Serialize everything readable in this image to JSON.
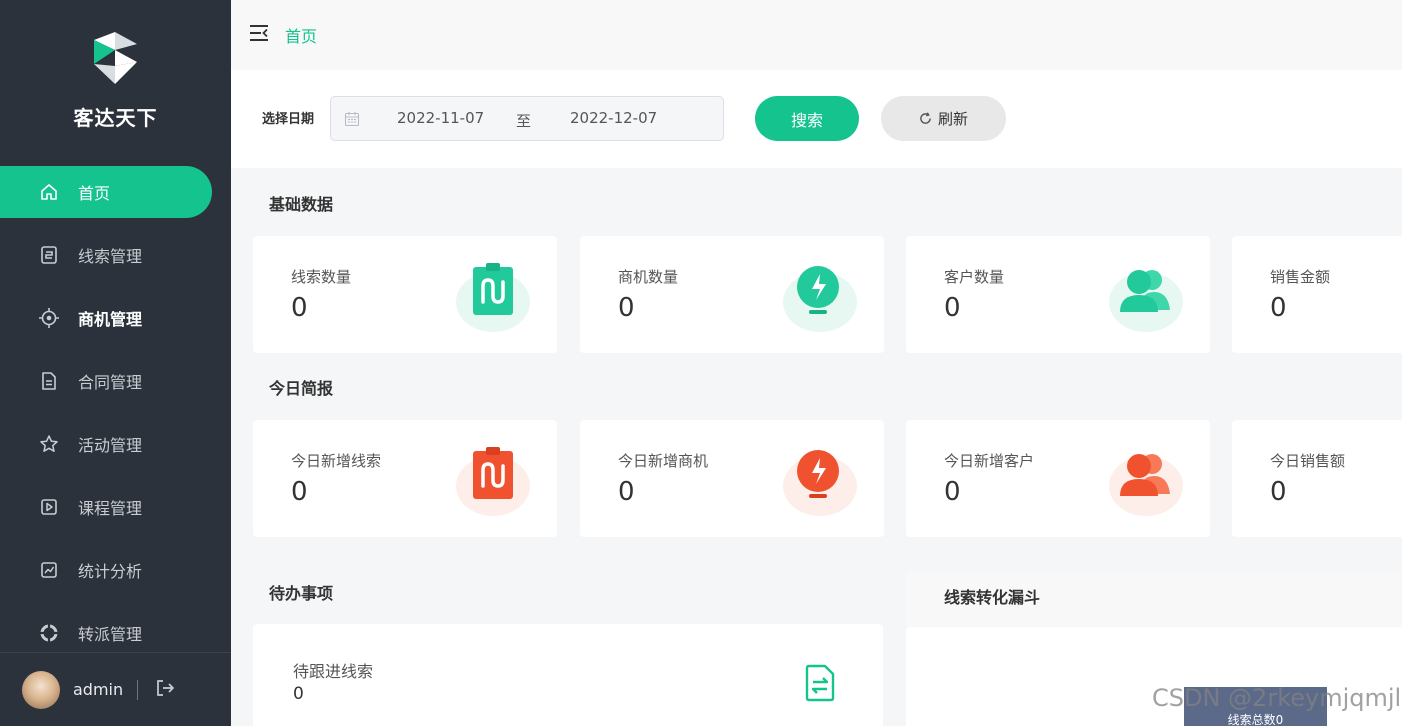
{
  "brand": {
    "name": "客达天下"
  },
  "sidebar": {
    "items": [
      {
        "label": "首页",
        "icon": "home-icon"
      },
      {
        "label": "线索管理",
        "icon": "clue-icon"
      },
      {
        "label": "商机管理",
        "icon": "target-icon"
      },
      {
        "label": "合同管理",
        "icon": "document-icon"
      },
      {
        "label": "活动管理",
        "icon": "star-icon"
      },
      {
        "label": "课程管理",
        "icon": "play-icon"
      },
      {
        "label": "统计分析",
        "icon": "chart-icon"
      },
      {
        "label": "转派管理",
        "icon": "transfer-icon"
      }
    ]
  },
  "user": {
    "name": "admin"
  },
  "header": {
    "breadcrumb": "首页"
  },
  "filter": {
    "label": "选择日期",
    "start": "2022-11-07",
    "separator": "至",
    "end": "2022-12-07",
    "search_label": "搜索",
    "refresh_label": "刷新"
  },
  "basic": {
    "title": "基础数据",
    "cards": [
      {
        "label": "线索数量",
        "value": "0"
      },
      {
        "label": "商机数量",
        "value": "0"
      },
      {
        "label": "客户数量",
        "value": "0"
      },
      {
        "label": "销售金额",
        "value": "0"
      }
    ]
  },
  "today": {
    "title": "今日简报",
    "cards": [
      {
        "label": "今日新增线索",
        "value": "0"
      },
      {
        "label": "今日新增商机",
        "value": "0"
      },
      {
        "label": "今日新增客户",
        "value": "0"
      },
      {
        "label": "今日销售额",
        "value": "0"
      }
    ]
  },
  "todo": {
    "title": "待办事项",
    "items": [
      {
        "label": "待跟进线索",
        "value": "0"
      }
    ]
  },
  "funnel": {
    "title": "线索转化漏斗",
    "total_label": "线索总数0"
  },
  "watermark": "CSDN @2rkeymjqmjl",
  "colors": {
    "accent": "#14c38e",
    "sidebar_bg": "#2b323b",
    "orange": "#f0522f"
  }
}
